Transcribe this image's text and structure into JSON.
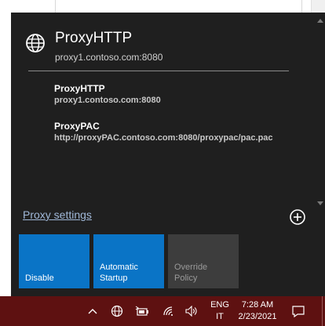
{
  "current_proxy": {
    "title": "ProxyHTTP",
    "address": "proxy1.contoso.com:8080",
    "icon": "globe-icon"
  },
  "proxies": [
    {
      "name": "ProxyHTTP",
      "address": "proxy1.contoso.com:8080"
    },
    {
      "name": "ProxyPAC",
      "address": "http://proxyPAC.contoso.com:8080/proxypac/pac.pac"
    }
  ],
  "footer": {
    "settings_label": "Proxy settings",
    "add_icon": "plus-circle-icon"
  },
  "tiles": [
    {
      "label": "Disable",
      "state": "active"
    },
    {
      "label": "Automatic Startup",
      "state": "active"
    },
    {
      "label": "Override Policy",
      "state": "inactive"
    }
  ],
  "taskbar": {
    "language_line1": "ENG",
    "language_line2": "IT",
    "time": "7:28 AM",
    "date": "2/23/2021",
    "icons": [
      "chevron-up-icon",
      "globe-icon",
      "battery-icon",
      "wifi-icon",
      "speaker-icon",
      "notification-icon"
    ]
  },
  "colors": {
    "flyout_bg": "#1f1f1f",
    "tile_active": "#0a74c6",
    "tile_inactive": "#3d3d3d",
    "taskbar_bg": "#5e1111",
    "link": "#a0b8d8"
  }
}
